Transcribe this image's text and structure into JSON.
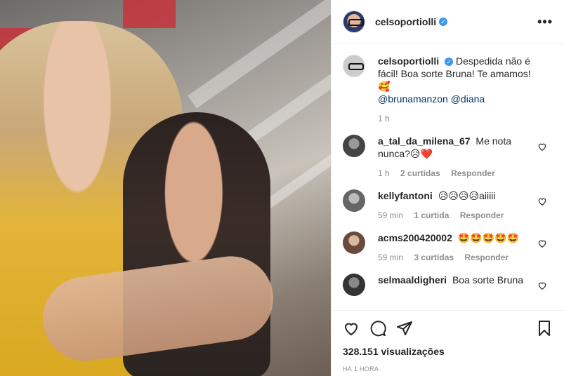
{
  "header": {
    "username": "celsoportiolli",
    "more_label": "•••"
  },
  "caption": {
    "username": "celsoportiolli",
    "text": "Despedida não é fácil! Boa sorte Bruna! Te amamos! 🥰",
    "mentions": [
      "@brunamanzon",
      "@diana"
    ],
    "time": "1 h"
  },
  "comments": [
    {
      "username": "a_tal_da_milena_67",
      "text": "Me nota nunca?😥❤️",
      "time": "1 h",
      "likes": "2 curtidas",
      "reply": "Responder"
    },
    {
      "username": "kellyfantoni",
      "text": "😥😥😥😥aiiiii",
      "time": "59 min",
      "likes": "1 curtida",
      "reply": "Responder"
    },
    {
      "username": "acms200420002",
      "text": "🤩🤩🤩🤩🤩",
      "time": "59 min",
      "likes": "3 curtidas",
      "reply": "Responder"
    },
    {
      "username": "selmaaldigheri",
      "text": "Boa sorte Bruna"
    }
  ],
  "footer": {
    "views": "328.151 visualizações",
    "posted": "HÁ 1 HORA"
  },
  "icons": {
    "verified": "verified-badge-icon",
    "like": "heart-icon",
    "comment": "comment-icon",
    "share": "share-icon",
    "save": "bookmark-icon"
  },
  "colors": {
    "link": "#00376b",
    "muted": "#8e8e8e",
    "verified": "#3897f0"
  }
}
